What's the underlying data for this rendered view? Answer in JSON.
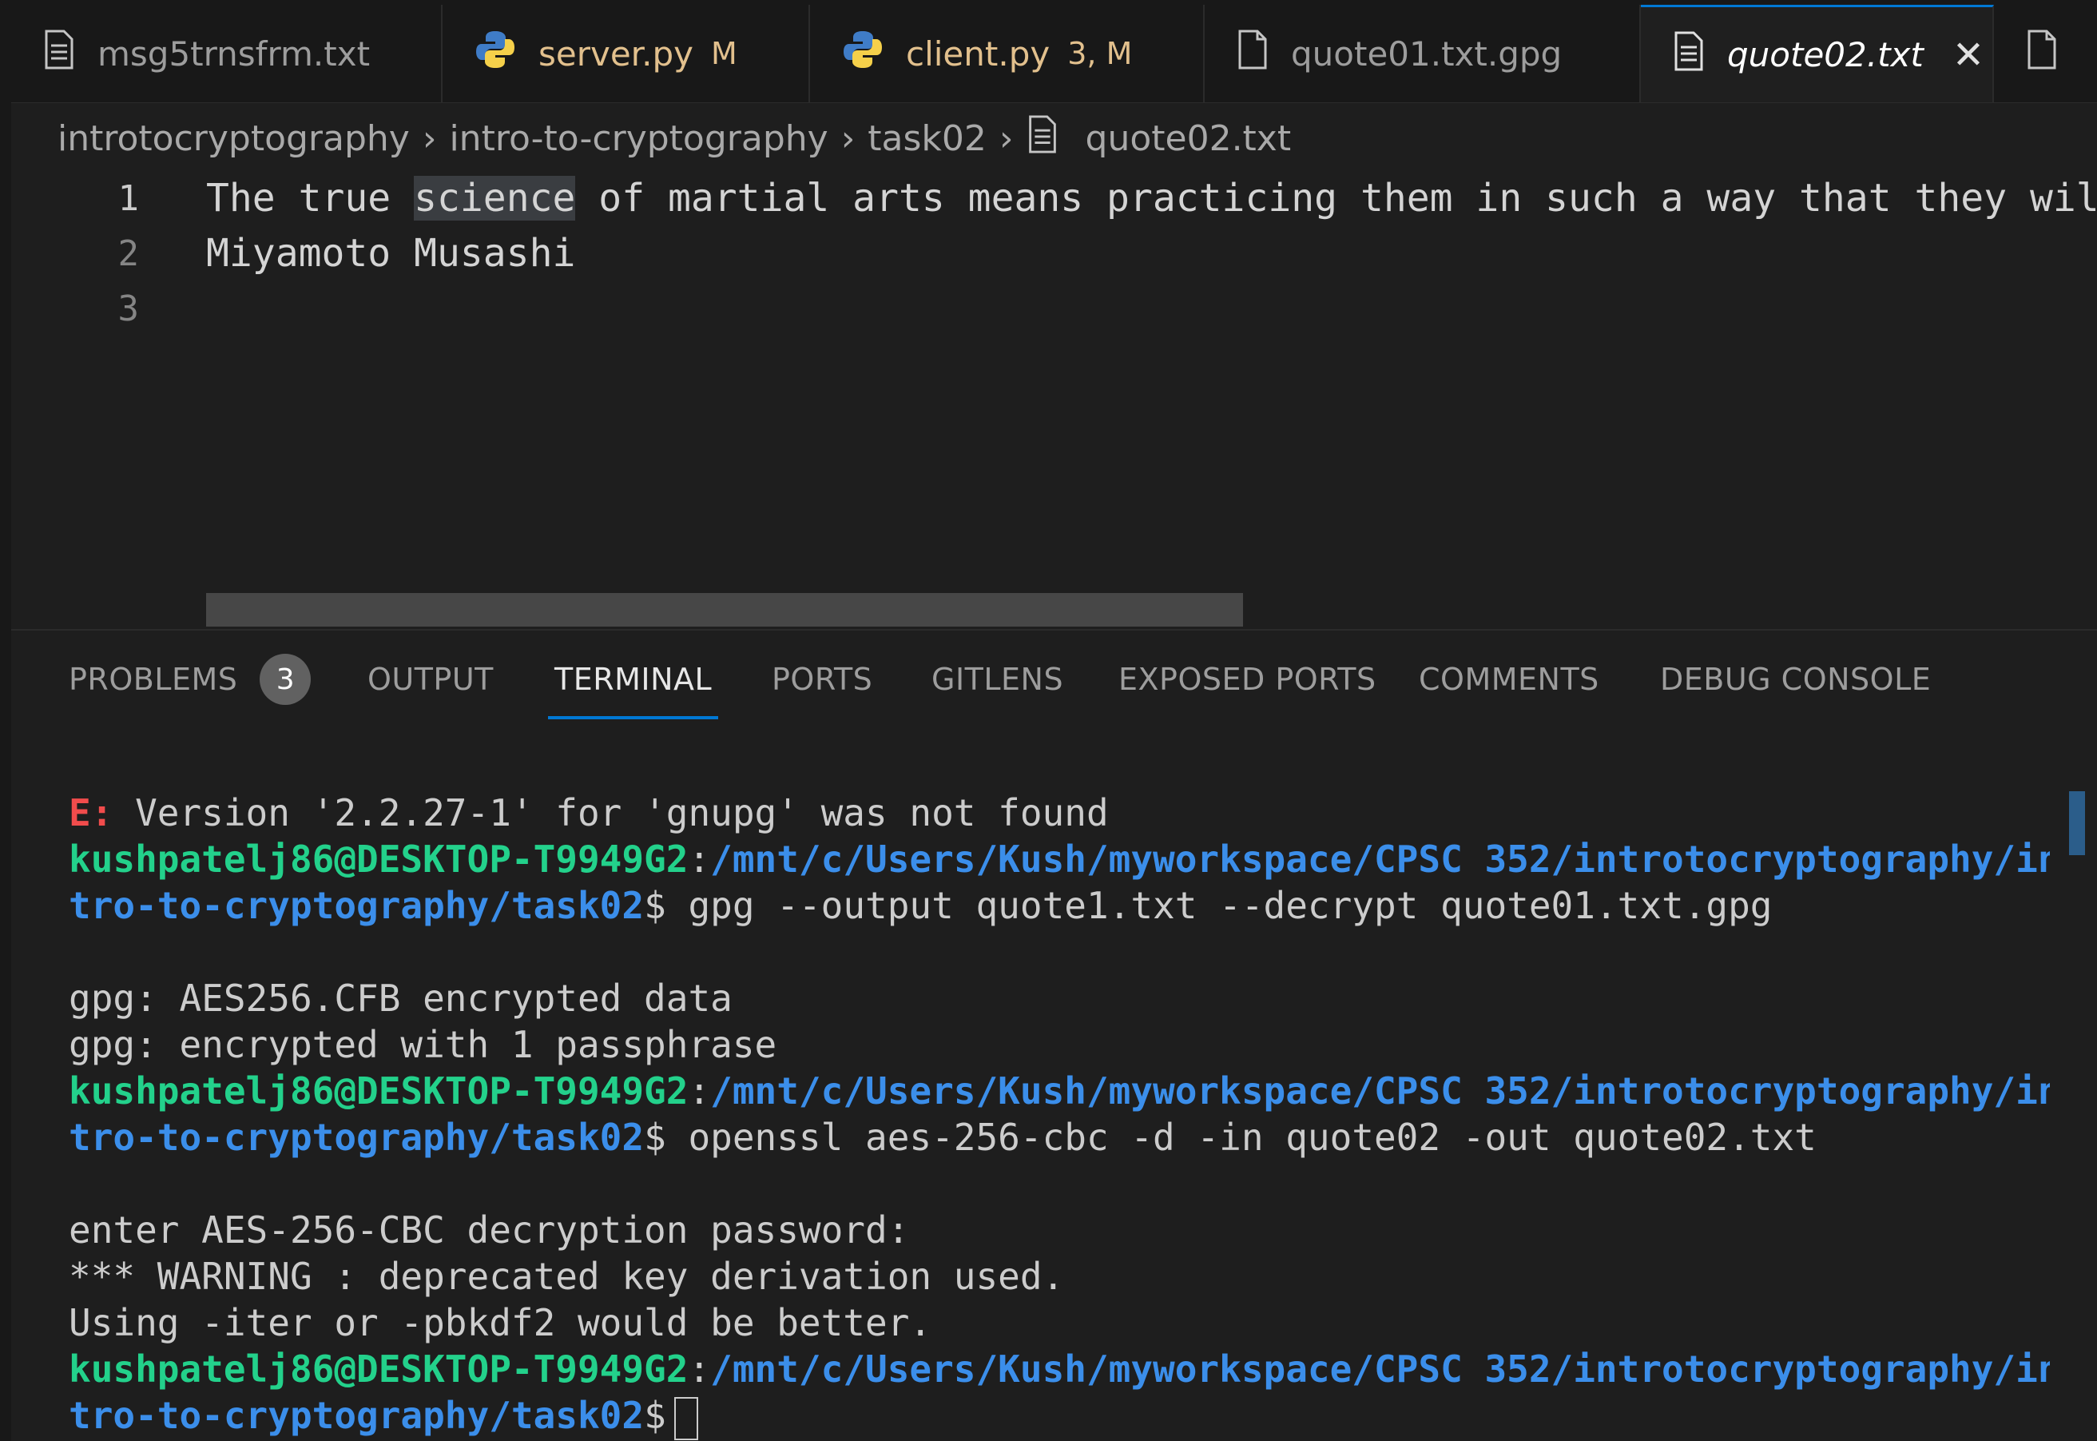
{
  "tabs": [
    {
      "name": "msg5trnsfrm.txt",
      "badge": "",
      "icon": "text-file-icon"
    },
    {
      "name": "server.py",
      "badge": "M",
      "icon": "python-icon"
    },
    {
      "name": "client.py",
      "badge": "3, M",
      "icon": "python-icon"
    },
    {
      "name": "quote01.txt.gpg",
      "badge": "",
      "icon": "blank-file-icon"
    },
    {
      "name": "quote02.txt",
      "badge": "",
      "icon": "text-file-icon",
      "active": true,
      "close": "✕"
    }
  ],
  "breadcrumb": [
    "introtocryptography",
    "intro-to-cryptography",
    "task02",
    "quote02.txt"
  ],
  "editor": {
    "lines": [
      {
        "n": "1",
        "before": "The true ",
        "hl": "science",
        "after": " of martial arts means practicing them in such a way that they will be"
      },
      {
        "n": "2",
        "text": "Miyamoto Musashi"
      },
      {
        "n": "3",
        "text": ""
      }
    ]
  },
  "panel": {
    "tabs": [
      "PROBLEMS",
      "OUTPUT",
      "TERMINAL",
      "PORTS",
      "GITLENS",
      "EXPOSED PORTS",
      "COMMENTS",
      "DEBUG CONSOLE"
    ],
    "problems_count": "3",
    "active": "TERMINAL"
  },
  "terminal": {
    "err_prefix": "E:",
    "err_msg": " Version '2.2.27-1' for 'gnupg' was not found",
    "user": "kushpatelj86@DESKTOP-T9949G2",
    "colon": ":",
    "path1": "/mnt/c/Users/Kush/myworkspace/CPSC 352/introtocryptography/in",
    "path2": "tro-to-cryptography/task02",
    "prompt": "$",
    "cmd1": " gpg --output quote1.txt --decrypt quote01.txt.gpg",
    "out1a": "gpg: AES256.CFB encrypted data",
    "out1b": "gpg: encrypted with 1 passphrase",
    "cmd2": " openssl aes-256-cbc -d -in quote02 -out quote02.txt",
    "out2a": "enter AES-256-CBC decryption password:",
    "out2b": "*** WARNING : deprecated key derivation used.",
    "out2c": "Using -iter or -pbkdf2 would be better."
  }
}
